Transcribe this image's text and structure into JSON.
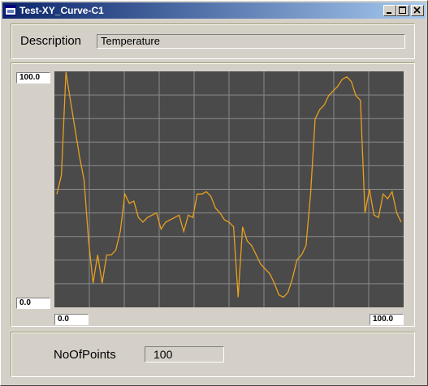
{
  "window": {
    "title": "Test-XY_Curve-C1"
  },
  "description": {
    "label": "Description",
    "value": "Temperature"
  },
  "chart": {
    "y_max_label": "100.0",
    "y_min_label": "0.0",
    "x_min_label": "0.0",
    "x_max_label": "100.0"
  },
  "points": {
    "label": "NoOfPoints",
    "value": "100"
  },
  "colors": {
    "titlebar_start": "#0a246a",
    "titlebar_end": "#a6caf0",
    "plot_bg": "#4a4a4a",
    "grid": "#8a8a8a",
    "curve": "#e8a020"
  },
  "chart_data": {
    "type": "line",
    "x": [
      0,
      1,
      2,
      3,
      4,
      5,
      6,
      7,
      8,
      9,
      10,
      11,
      12,
      13,
      14,
      15,
      16,
      17,
      18,
      19,
      20,
      21,
      22,
      23,
      24,
      25,
      26,
      27,
      28,
      29,
      30,
      31,
      32,
      33,
      34,
      35,
      36,
      37,
      38,
      39,
      40,
      41,
      42,
      43,
      44,
      45,
      46,
      47,
      48,
      49,
      50,
      51,
      52,
      53,
      54,
      55,
      56,
      57,
      58,
      59,
      60,
      61,
      62,
      63,
      64,
      65,
      66,
      67,
      68,
      69,
      70,
      71,
      72,
      73,
      74,
      75,
      76,
      77,
      78,
      79,
      80,
      81,
      82,
      83,
      84,
      85,
      86,
      87,
      88,
      89,
      90,
      91,
      92,
      93,
      94,
      95,
      96,
      97,
      98,
      99
    ],
    "values": [
      48,
      56,
      100,
      88,
      76,
      64,
      54,
      28,
      10,
      22,
      10,
      22,
      22,
      24,
      32,
      48,
      44,
      45,
      38,
      36,
      38,
      39,
      40,
      33,
      36,
      37,
      38,
      39,
      32,
      39,
      38,
      48,
      48,
      49,
      47,
      42,
      40,
      37,
      36,
      34,
      4,
      34,
      28,
      26,
      22,
      18,
      16,
      14,
      10,
      5,
      4,
      6,
      12,
      20,
      22,
      26,
      48,
      80,
      84,
      86,
      90,
      92,
      94,
      97,
      98,
      96,
      90,
      88,
      40,
      50,
      39,
      38,
      48,
      46,
      49,
      40,
      36
    ],
    "xlim": [
      0,
      100
    ],
    "ylim": [
      0,
      100
    ],
    "grid": true
  }
}
